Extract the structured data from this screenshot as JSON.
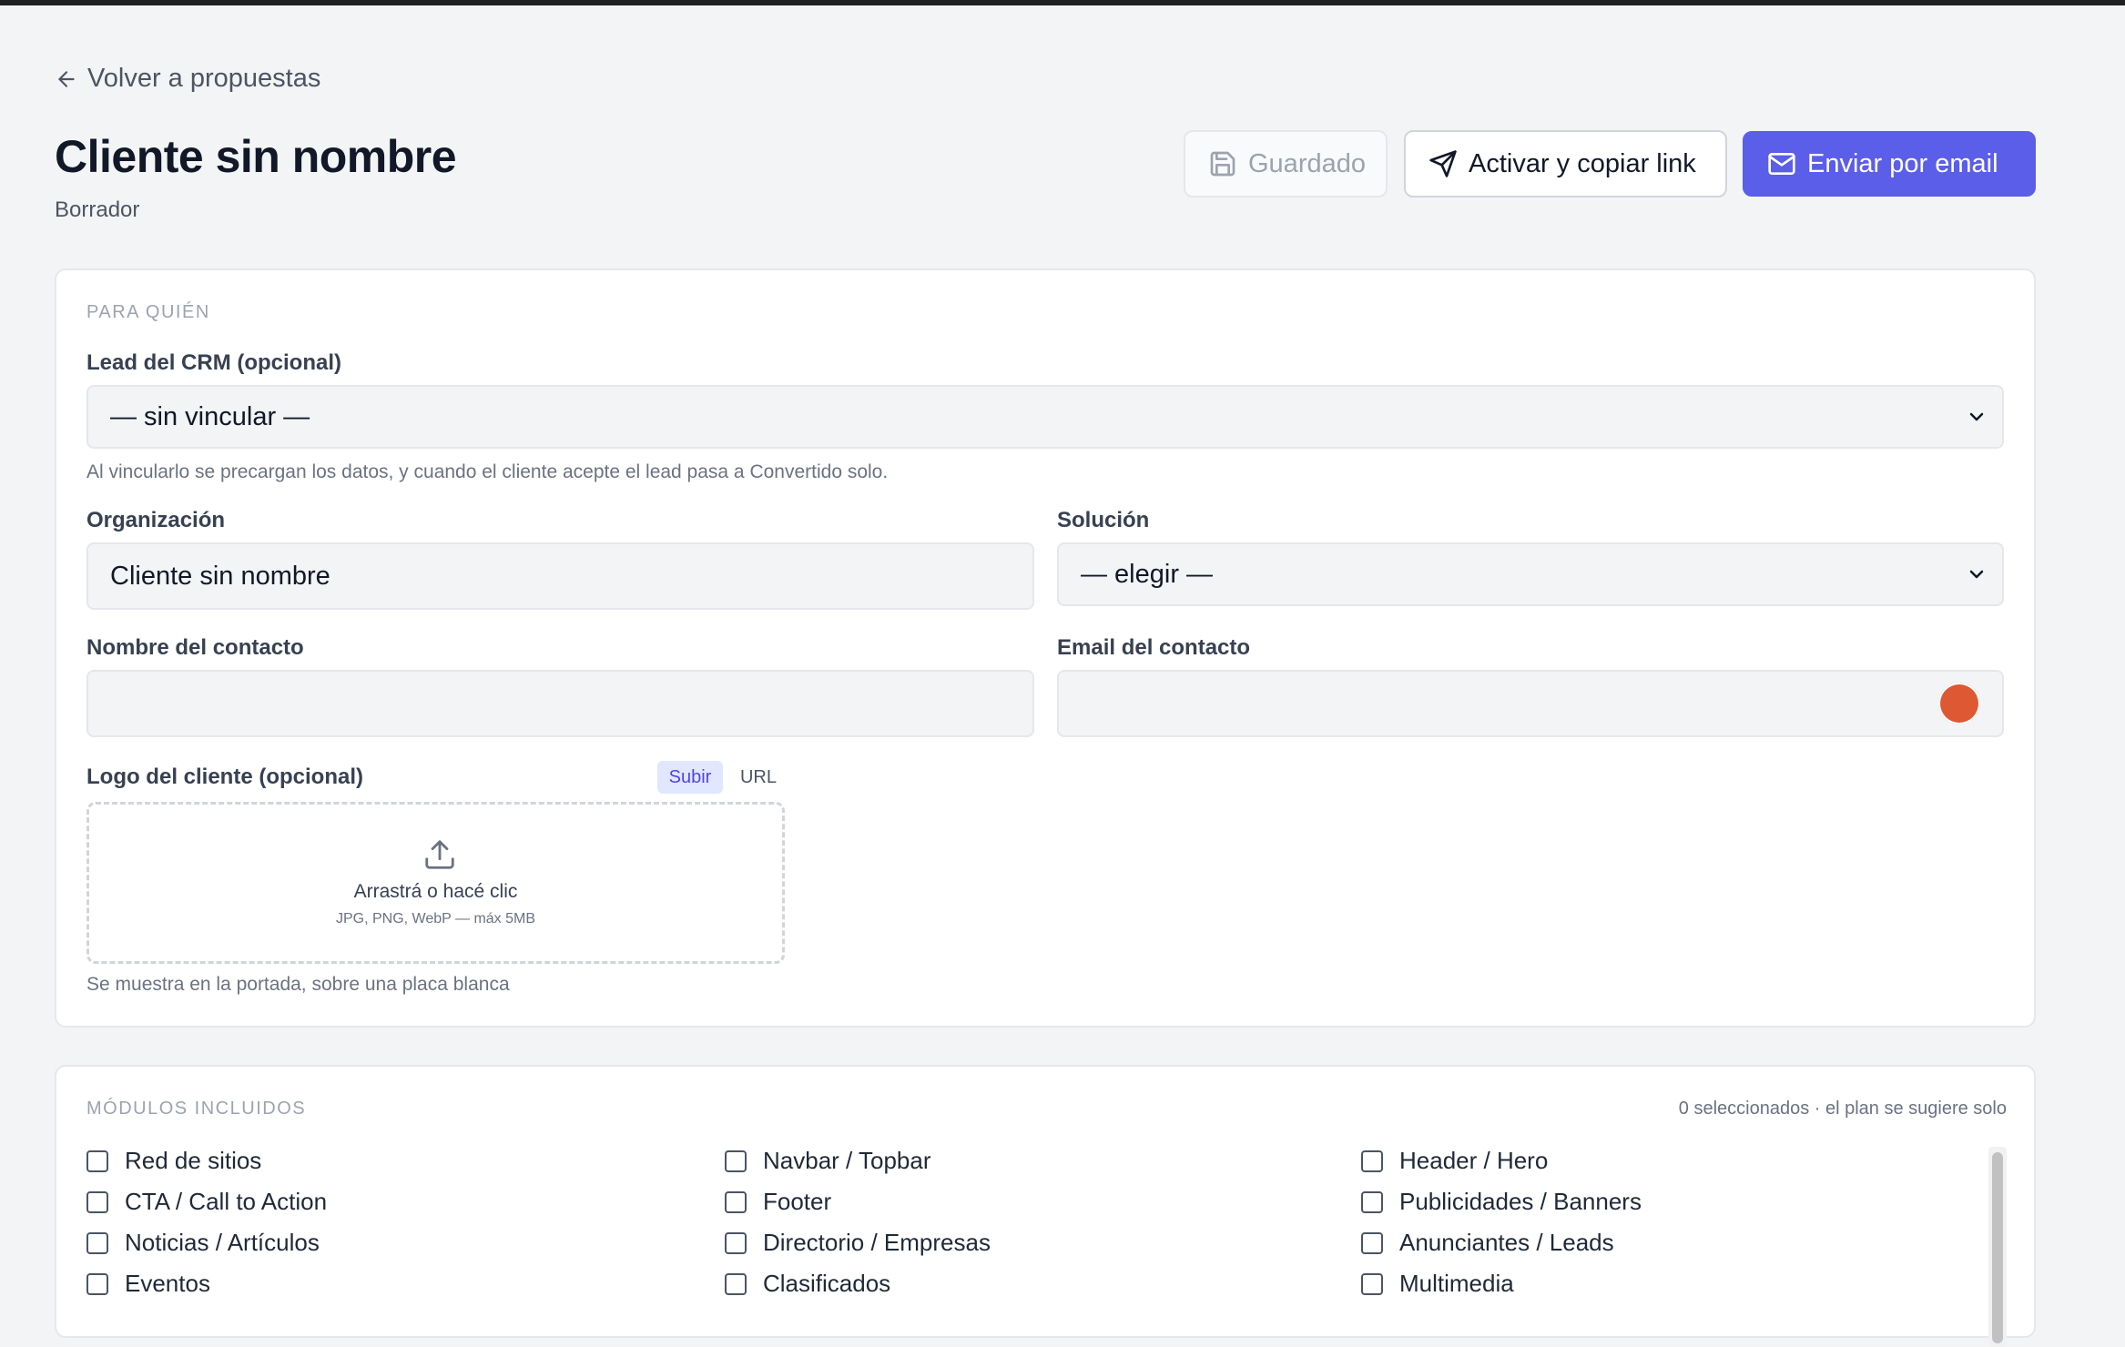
{
  "nav": {
    "back_label": "Volver a propuestas"
  },
  "header": {
    "title": "Cliente sin nombre",
    "status": "Borrador",
    "buttons": {
      "saved": "Guardado",
      "activate": "Activar y copiar link",
      "email": "Enviar por email"
    }
  },
  "colors": {
    "primary": "#5b5ee8",
    "background": "#f3f4f6",
    "topbar": "#1f2023"
  },
  "para_quien": {
    "section_title": "PARA QUIÉN",
    "lead": {
      "label": "Lead del CRM (opcional)",
      "value": "— sin vincular —",
      "hint": "Al vincularlo se precargan los datos, y cuando el cliente acepte el lead pasa a Convertido solo."
    },
    "organizacion": {
      "label": "Organización",
      "value": "Cliente sin nombre"
    },
    "solucion": {
      "label": "Solución",
      "value": "— elegir —"
    },
    "nombre_contacto": {
      "label": "Nombre del contacto",
      "value": ""
    },
    "email_contacto": {
      "label": "Email del contacto",
      "value": ""
    },
    "logo": {
      "label": "Logo del cliente (opcional)",
      "tab_upload": "Subir",
      "tab_url": "URL",
      "drop_main": "Arrastrá o hacé clic",
      "drop_sub": "JPG, PNG, WebP — máx 5MB",
      "hint": "Se muestra en la portada, sobre una placa blanca"
    }
  },
  "modulos": {
    "section_title": "MÓDULOS INCLUIDOS",
    "count_text": "0 seleccionados · el plan se sugiere solo",
    "items": [
      "Red de sitios",
      "Navbar / Topbar",
      "Header / Hero",
      "CTA / Call to Action",
      "Footer",
      "Publicidades / Banners",
      "Noticias / Artículos",
      "Directorio / Empresas",
      "Anunciantes / Leads",
      "Eventos",
      "Clasificados",
      "Multimedia"
    ]
  }
}
